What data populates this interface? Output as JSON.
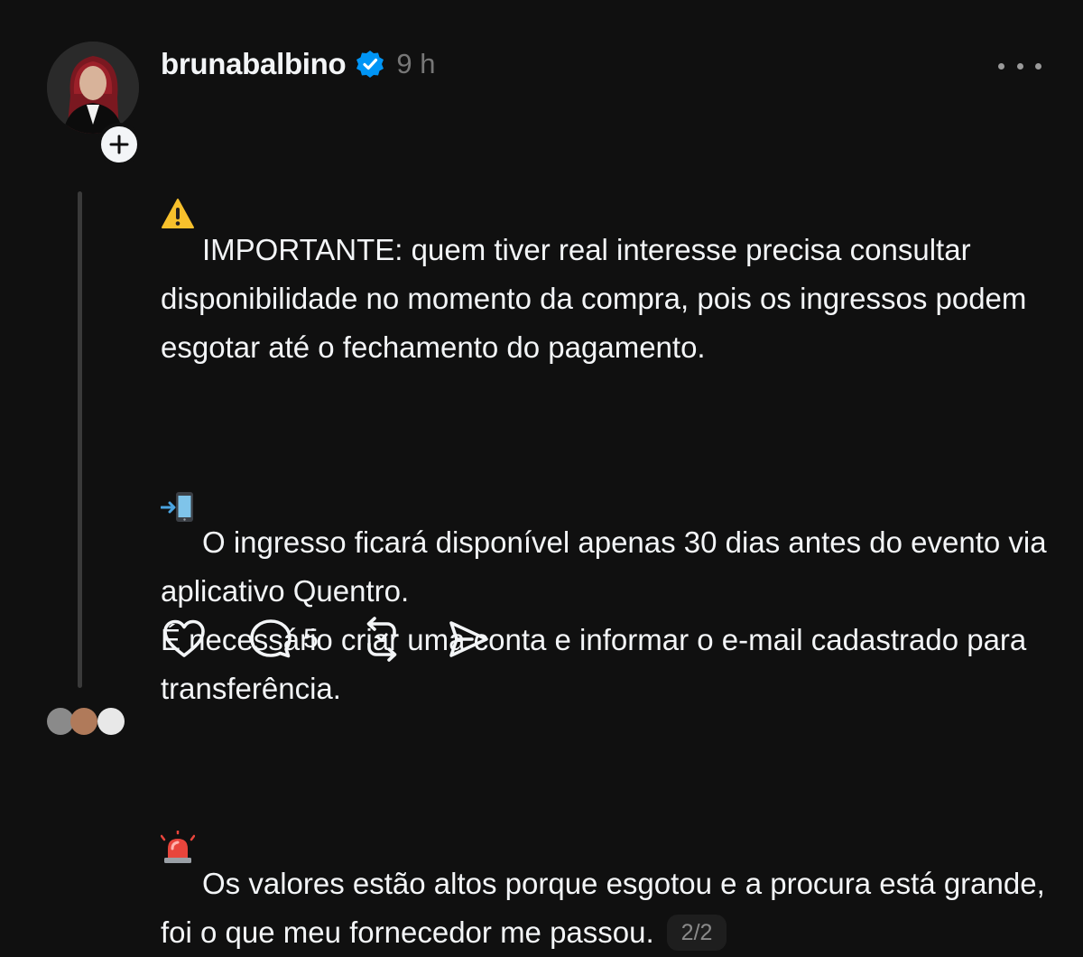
{
  "post": {
    "username": "brunabalbino",
    "verified_icon": "verified-badge-icon",
    "timestamp": "9 h",
    "paragraphs": [
      {
        "emoji": "warning-emoji",
        "text": "IMPORTANTE: quem tiver real interesse precisa consultar disponibilidade no momento da compra, pois os ingressos podem esgotar até o fechamento do pagamento."
      },
      {
        "emoji": "mobile-phone-arrow-emoji",
        "text": "O ingresso ficará disponível apenas 30 dias antes do evento via aplicativo Quentro.\nÉ necessário criar uma conta e informar o e-mail cadastrado para transferência."
      },
      {
        "emoji": "police-light-emoji",
        "text": "Os valores estão altos porque esgotou e a procura está grande, foi o que meu fornecedor me passou."
      }
    ],
    "page_indicator": "2/2"
  },
  "actions": {
    "like_icon": "heart-icon",
    "reply_icon": "comment-icon",
    "reply_count": "5",
    "repost_icon": "repost-icon",
    "share_icon": "send-icon"
  },
  "colors": {
    "background": "#101010",
    "text": "#f3f5f7",
    "muted": "#777777",
    "verified": "#0095f6",
    "thread_line": "#3a3a3a"
  }
}
